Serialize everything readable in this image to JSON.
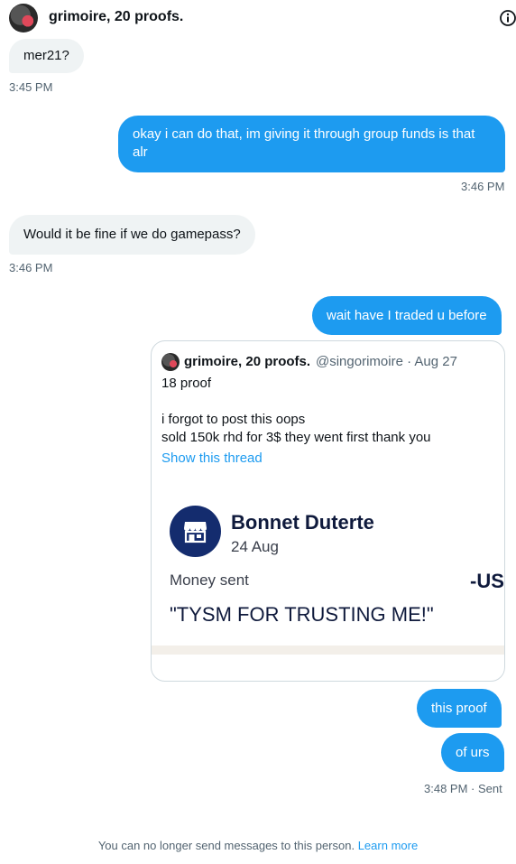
{
  "header": {
    "title": "grimoire, 20 proofs.",
    "info_icon": "info-circle-icon"
  },
  "messages": [
    {
      "direction": "in",
      "text": "mer21?"
    },
    {
      "direction": "out",
      "text": "okay i can do that, im giving it through group funds is that alr"
    },
    {
      "direction": "in",
      "text": "Would it be fine if we do gamepass?"
    },
    {
      "direction": "out",
      "text": "wait have I traded u before"
    },
    {
      "direction": "out",
      "text": "this proof"
    },
    {
      "direction": "out",
      "text": "of urs"
    }
  ],
  "timestamps": {
    "t1": "3:45 PM",
    "t2": "3:46 PM",
    "t3": "3:46 PM",
    "t4": "3:48 PM · Sent"
  },
  "quote": {
    "name": "grimoire, 20 proofs.",
    "meta": "@singorimoire · Aug 27",
    "line1": "18 proof",
    "line2": "i forgot to post this oops",
    "line3": "sold 150k rhd for 3$ they went first thank you",
    "link": "Show this thread",
    "receipt": {
      "name": "Bonnet Duterte",
      "date": "24 Aug",
      "sent_label": "Money sent",
      "amount": "-US",
      "note": "\"TYSM FOR TRUSTING ME!\"",
      "icon": "storefront-icon"
    }
  },
  "footer": {
    "text": "You can no longer send messages to this person.",
    "link": "Learn more"
  },
  "colors": {
    "accent": "#1d9bf0",
    "incoming_bubble": "#eff3f4",
    "muted": "#536471",
    "receipt_navy": "#142c6e"
  }
}
